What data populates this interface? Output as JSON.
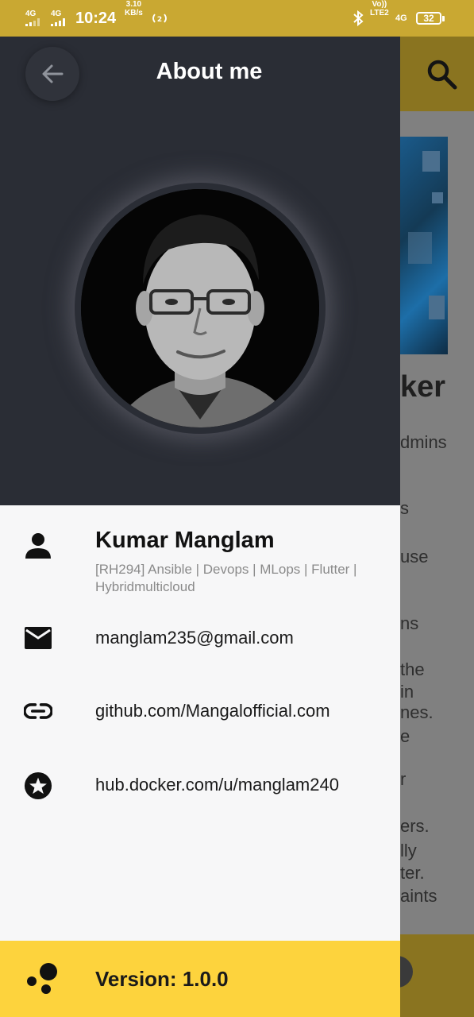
{
  "status_bar": {
    "net1": "4G",
    "net2": "4G",
    "time": "10:24",
    "speed_value": "3.10",
    "speed_unit": "KB/s",
    "volte_top": "Vo))",
    "volte_bottom": "LTE2",
    "net3": "4G",
    "battery": "32"
  },
  "background": {
    "title_fragment": "ker",
    "lines": [
      "dmins",
      "s",
      "use",
      "ns",
      "the",
      "in",
      "nes.",
      "e",
      "r",
      "ers.",
      "lly",
      "ter.",
      "aints"
    ]
  },
  "drawer": {
    "header_title": "About me",
    "name": "Kumar Manglam",
    "subtitle": "[RH294] Ansible | Devops | MLops | Flutter | Hybridmulticloud",
    "email": "manglam235@gmail.com",
    "github": "github.com/Mangalofficial.com",
    "docker": "hub.docker.com/u/manglam240",
    "version": "Version: 1.0.0"
  },
  "colors": {
    "status_bar": "#c9a832",
    "header_bg": "#2a2d35",
    "drawer_bg": "#f7f7f8",
    "version_bar": "#fdd33d"
  }
}
